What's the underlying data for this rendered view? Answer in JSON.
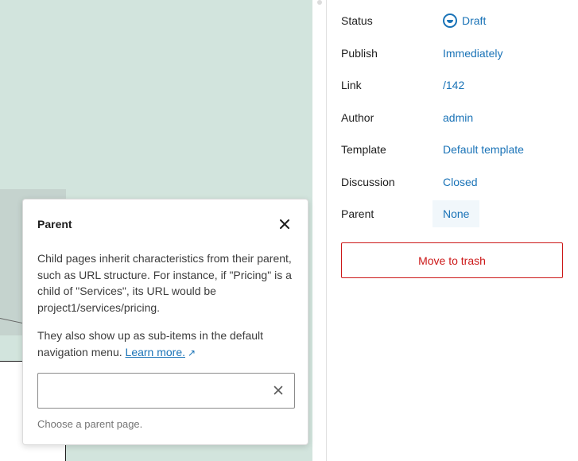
{
  "summary": {
    "rows": [
      {
        "label": "Status",
        "value": "Draft"
      },
      {
        "label": "Publish",
        "value": "Immediately"
      },
      {
        "label": "Link",
        "value": "/142"
      },
      {
        "label": "Author",
        "value": "admin"
      },
      {
        "label": "Template",
        "value": "Default template"
      },
      {
        "label": "Discussion",
        "value": "Closed"
      },
      {
        "label": "Parent",
        "value": "None"
      }
    ],
    "trash_label": "Move to trash"
  },
  "popover": {
    "title": "Parent",
    "paragraph1": "Child pages inherit characteristics from their parent, such as URL structure. For instance, if \"Pricing\" is a child of \"Services\", its URL would be project1/services/pricing.",
    "paragraph2": "They also show up as sub-items in the default navigation menu.",
    "learn_more": "Learn more.",
    "external_arrow": "↗",
    "input_value": "",
    "help_text": "Choose a parent page."
  },
  "colors": {
    "accent": "#1a73b7",
    "danger": "#cc1818",
    "canvas": "#d2e4dd"
  }
}
